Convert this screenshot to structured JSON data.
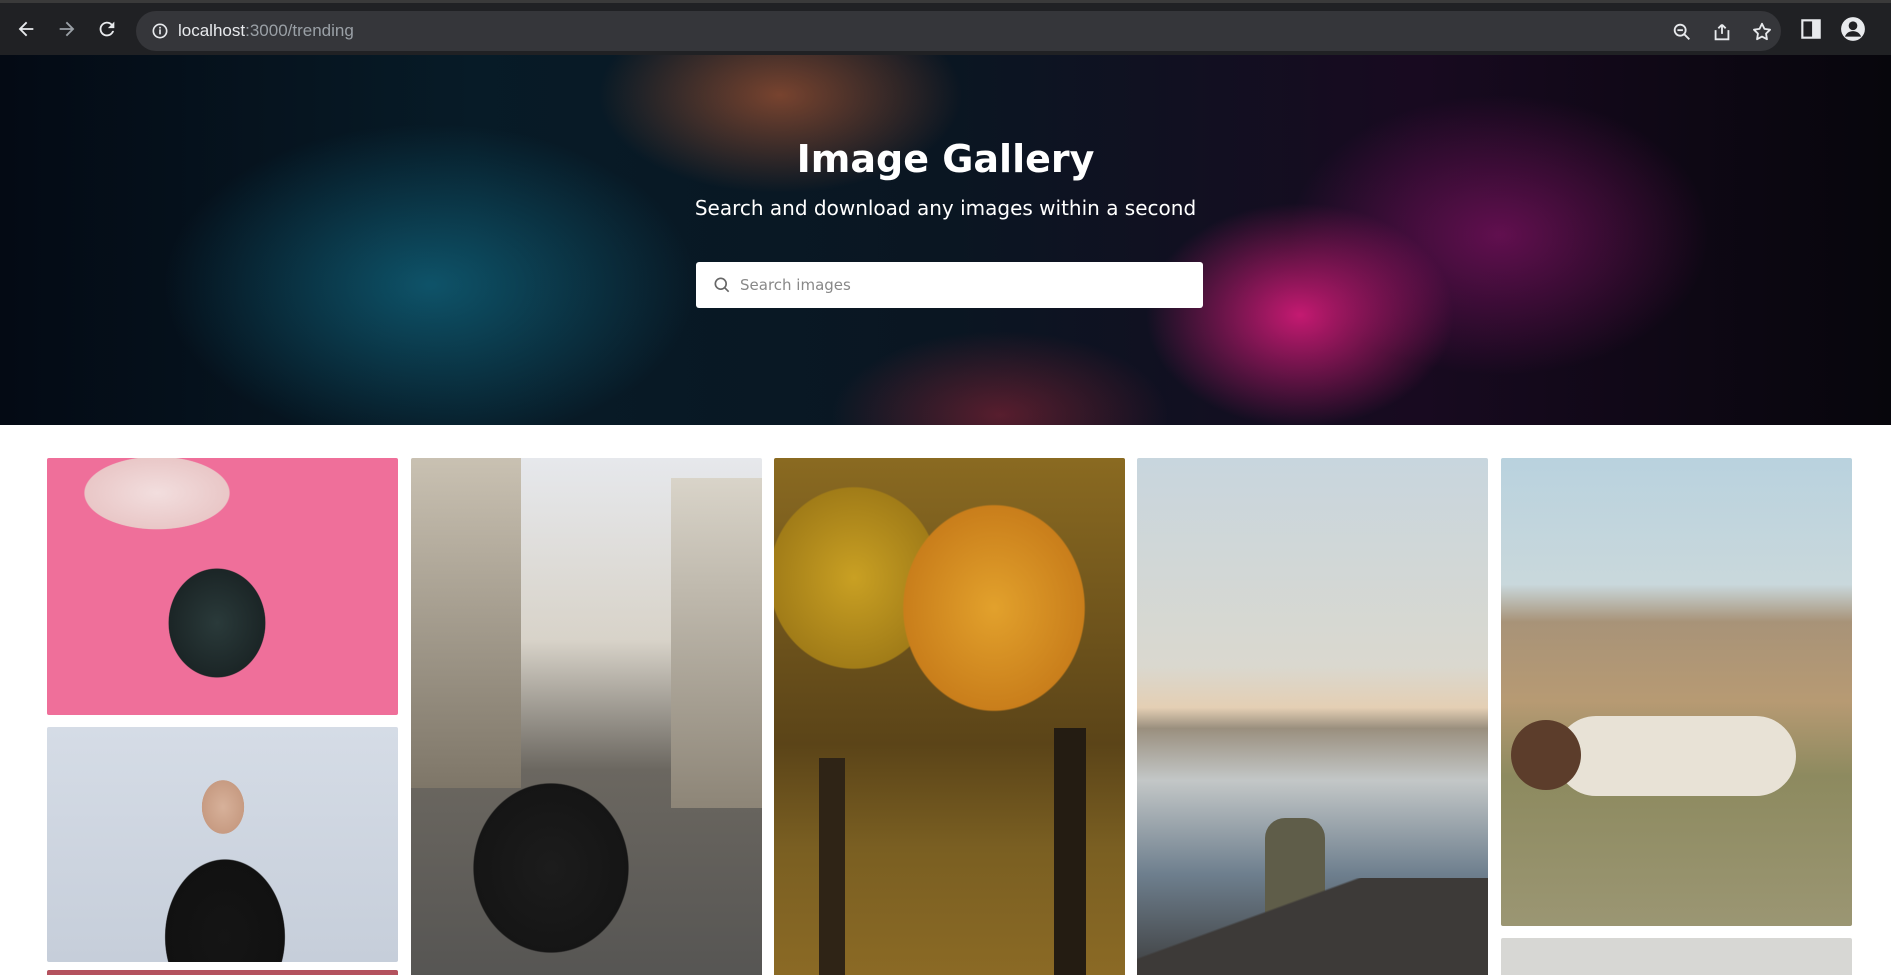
{
  "browser": {
    "url_host": "localhost",
    "url_rest": ":3000/trending"
  },
  "hero": {
    "title": "Image Gallery",
    "subtitle": "Search and download any images within a second",
    "search_placeholder": "Search images"
  },
  "gallery": {
    "items": [
      {
        "subject": "person with headphones on pink background"
      },
      {
        "subject": "man in black t-shirt"
      },
      {
        "subject": "cyclist on Paris street"
      },
      {
        "subject": "autumn forest"
      },
      {
        "subject": "couple by waterfront at sunset"
      },
      {
        "subject": "horses in mountain field"
      }
    ]
  },
  "colors": {
    "chrome_bg": "#202124",
    "omnibox_bg": "#35363a",
    "hero_text": "#ffffff"
  }
}
